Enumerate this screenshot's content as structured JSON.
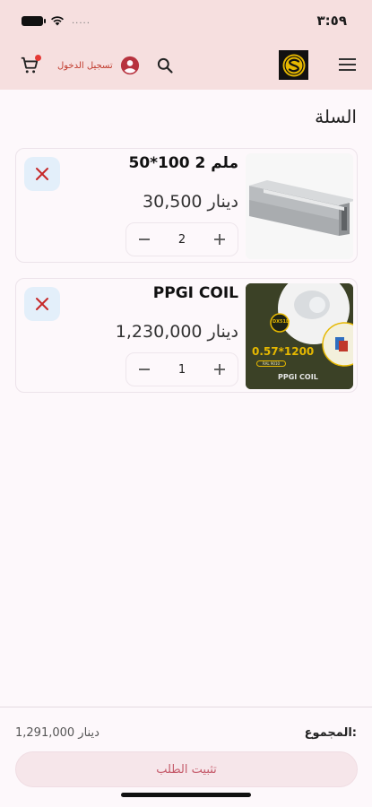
{
  "status_bar": {
    "time": "٣:٥٩",
    "carrier": "....."
  },
  "app_bar": {
    "login_label": "تسجيل الدخول"
  },
  "page": {
    "title": "السلة"
  },
  "cart_items": [
    {
      "name": "50*100 2 ملم",
      "price": "30,500 دينار",
      "quantity": "2"
    },
    {
      "name": "PPGI COIL",
      "price": "1,230,000 دينار",
      "quantity": "1",
      "image_text": {
        "badge": "DX51D",
        "size": "0.57*1200",
        "grade": "RAL 9010",
        "caption": "PPGI COIL"
      }
    }
  ],
  "summary": {
    "total_label": "المجموع:",
    "total_value": "1,291,000 دينار"
  },
  "checkout": {
    "label": "تثبيت الطلب"
  },
  "colors": {
    "header_bg": "#f6dfdf",
    "remove_bg": "#e3effa",
    "accent": "#c0392b",
    "checkout_bg": "#f6e6ea"
  }
}
